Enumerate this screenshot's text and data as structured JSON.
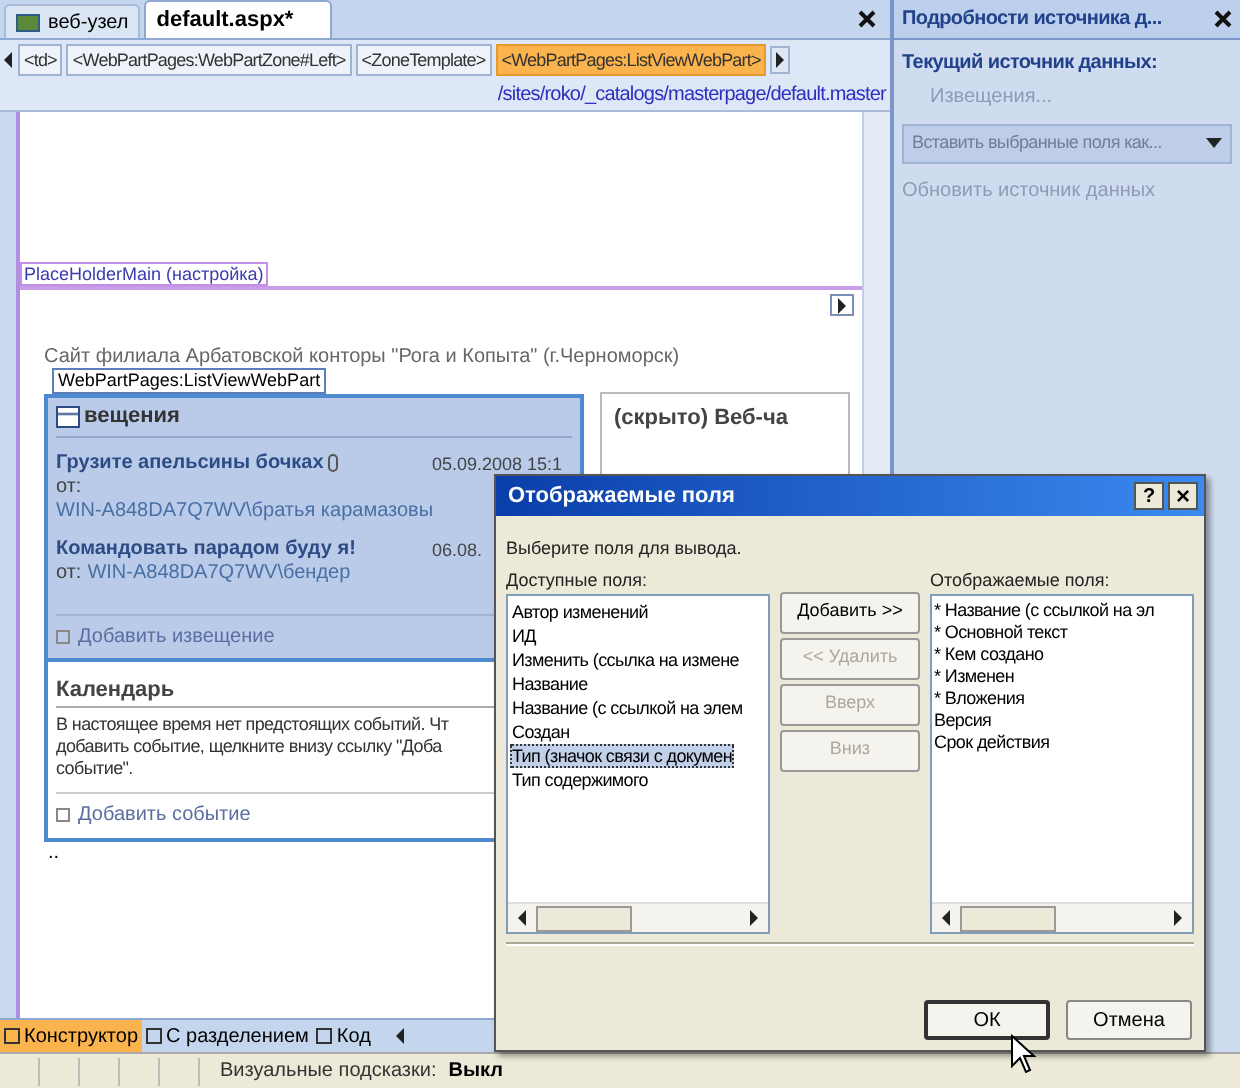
{
  "editor_tabs": [
    {
      "label": "веб-узел",
      "selected": false
    },
    {
      "label": "default.aspx*",
      "selected": true
    }
  ],
  "breadcrumbs": [
    {
      "label": "<td>",
      "selected": false
    },
    {
      "label": "<WebPartPages:WebPartZone#Left>",
      "selected": false
    },
    {
      "label": "<ZoneTemplate>",
      "selected": false
    },
    {
      "label": "<WebPartPages:ListViewWebPart>",
      "selected": true
    }
  ],
  "path": "/sites/roko/_catalogs/masterpage/default.master",
  "placeholder_label": "PlaceHolderMain (настройка)",
  "site_title": "Сайт филиала Арбатовской конторы \"Рога и Копыта\" (г.Черноморск)",
  "webpart_label": "WebPartPages:ListViewWebPart",
  "announcements": {
    "title": "вещения",
    "add_link": "Добавить извещение",
    "items": [
      {
        "kind": "wrapped",
        "title": "Грузите апельсины бочках",
        "attachment": true,
        "date": "05.09.2008 15:1",
        "by_label": "от:",
        "author": "WIN-A848DA7Q7WV\\братья карамазовы"
      },
      {
        "kind": "inline",
        "title": "Командовать парадом буду я!",
        "attachment": false,
        "date": "06.08.",
        "by_label": "от:",
        "author": "WIN-A848DA7Q7WV\\бендер"
      }
    ]
  },
  "calendar": {
    "title": "Календарь",
    "lines": [
      "В настоящее время нет предстоящих событий. Чт",
      "добавить событие, щелкните внизу ссылку \"Доба",
      "событие\"."
    ],
    "add_link": "Добавить событие"
  },
  "hidden_part_title": "(скрыто) Веб-ча",
  "dots": "..",
  "view_tabs": [
    {
      "label": "Конструктор",
      "selected": true
    },
    {
      "label": "С разделением",
      "selected": false
    },
    {
      "label": "Код",
      "selected": false
    }
  ],
  "status_bar": {
    "label": "Визуальные подсказки:",
    "value": "Выкл"
  },
  "task_pane": {
    "title": "Подробности источника д...",
    "heading": "Текущий источник данных:",
    "source": "Извещения...",
    "insert_dropdown": {
      "label": "Вставить выбранные поля как...",
      "disabled": true
    },
    "refresh_link": {
      "label": "Обновить источник данных",
      "disabled": true
    }
  },
  "dialog": {
    "title": "Отображаемые поля",
    "help": "?",
    "close": "×",
    "instruction": "Выберите поля для вывода.",
    "available_label": "Доступные поля:",
    "displayed_label": "Отображаемые поля:",
    "available": [
      {
        "label": "Автор изменений",
        "selected": false
      },
      {
        "label": "ИД",
        "selected": false
      },
      {
        "label": "Изменить (ссылка на измене",
        "selected": false
      },
      {
        "label": "Название",
        "selected": false
      },
      {
        "label": "Название (с ссылкой на элем",
        "selected": false
      },
      {
        "label": "Создан",
        "selected": false
      },
      {
        "label": "Тип (значок связи с докумен",
        "selected": true
      },
      {
        "label": "Тип содержимого",
        "selected": false
      }
    ],
    "displayed": [
      "* Название (с ссылкой на эл",
      "* Основной текст",
      "* Кем создано",
      "* Изменен",
      "* Вложения",
      "Версия",
      "Срок действия"
    ],
    "buttons": [
      {
        "label": "Добавить >>",
        "disabled": false
      },
      {
        "label": "<< Удалить",
        "disabled": true
      },
      {
        "label": "Вверх",
        "disabled": true
      },
      {
        "label": "Вниз",
        "disabled": true
      }
    ],
    "ok": "ОК",
    "cancel": "Отмена"
  }
}
